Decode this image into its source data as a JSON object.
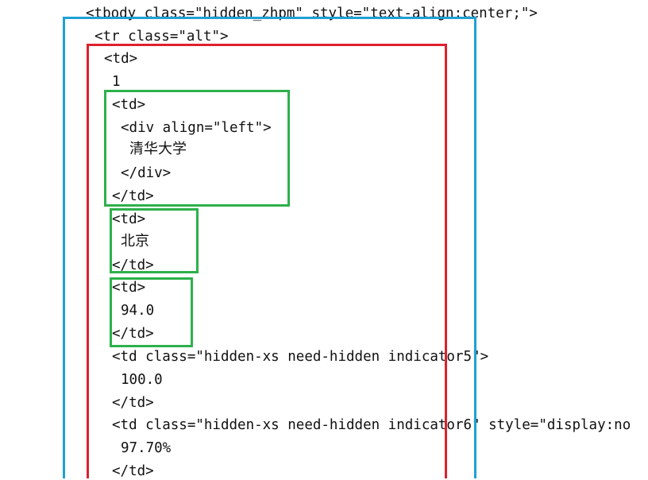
{
  "code": {
    "lines": [
      "<tbody class=\"hidden_zhpm\" style=\"text-align:center;\">",
      "<tr class=\"alt\">",
      "<td>",
      "1",
      "<td>",
      "<div align=\"left\">",
      "清华大学",
      "</div>",
      "</td>",
      "<td>",
      "北京",
      "</td>",
      "<td>",
      "94.0",
      "</td>",
      "<td class=\"hidden-xs need-hidden indicator5\">",
      "100.0",
      "</td>",
      "<td class=\"hidden-xs need-hidden indicator6\" style=\"display:no",
      "97.70%",
      "</td>"
    ]
  },
  "highlight_colors": {
    "tbody_box": "#1ea1d6",
    "row_box": "#e0202d",
    "cell_box": "#2db04b"
  }
}
